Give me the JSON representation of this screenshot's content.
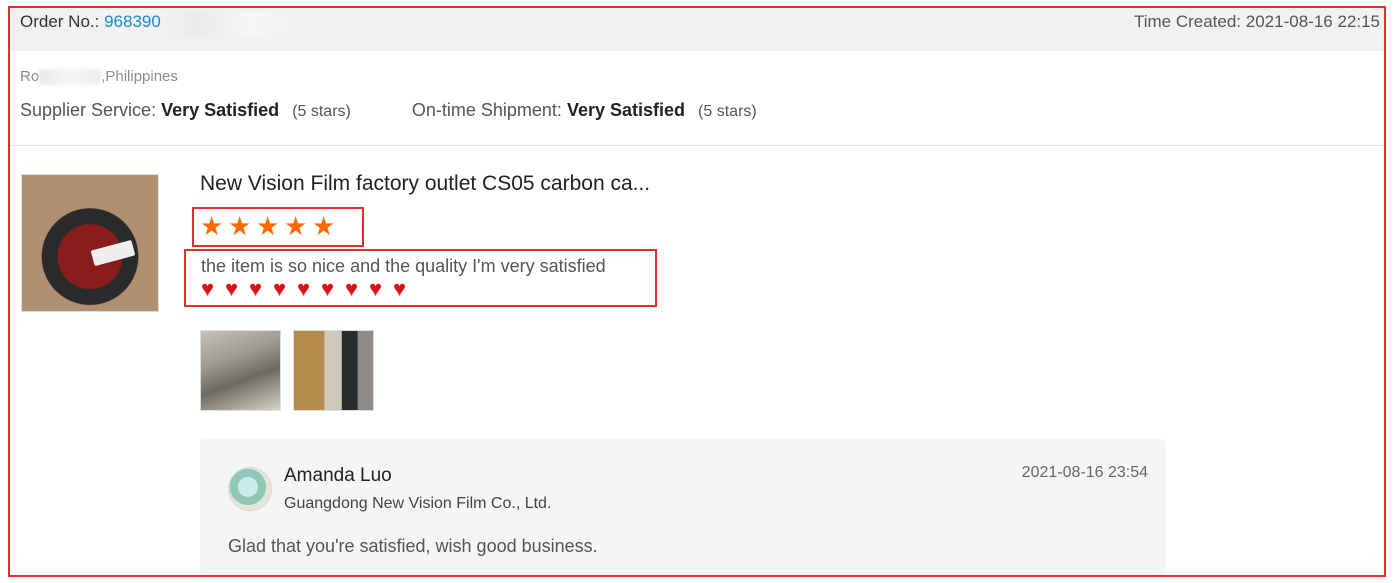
{
  "header": {
    "order_label": "Order No.:",
    "order_number": "968390",
    "time_created_label": "Time Created:",
    "time_created": "2021-08-16 22:15"
  },
  "buyer": {
    "name_prefix": "Ro",
    "location": ",Philippines"
  },
  "service_ratings": [
    {
      "label": "Supplier Service:",
      "value": "Very Satisfied",
      "stars": "(5 stars)"
    },
    {
      "label": "On-time Shipment:",
      "value": "Very Satisfied",
      "stars": "(5 stars)"
    }
  ],
  "product": {
    "title": "New Vision Film factory outlet CS05 carbon ca...",
    "rating_stars": 5,
    "review_text": "the item is so nice and the quality I'm very satisfied",
    "heart_emoji_count": 9,
    "photos": [
      "review-photo-1",
      "review-photo-2"
    ]
  },
  "reply": {
    "name": "Amanda Luo",
    "company": "Guangdong New Vision Film Co., Ltd.",
    "time": "2021-08-16 23:54",
    "text": "Glad that you're satisfied, wish good business."
  },
  "colors": {
    "highlight_border": "#e03131",
    "star": "#ff6a00",
    "link": "#1e88d2",
    "heart": "#d7141a"
  },
  "icons": {
    "star": "star-icon",
    "heart": "heart-icon"
  }
}
